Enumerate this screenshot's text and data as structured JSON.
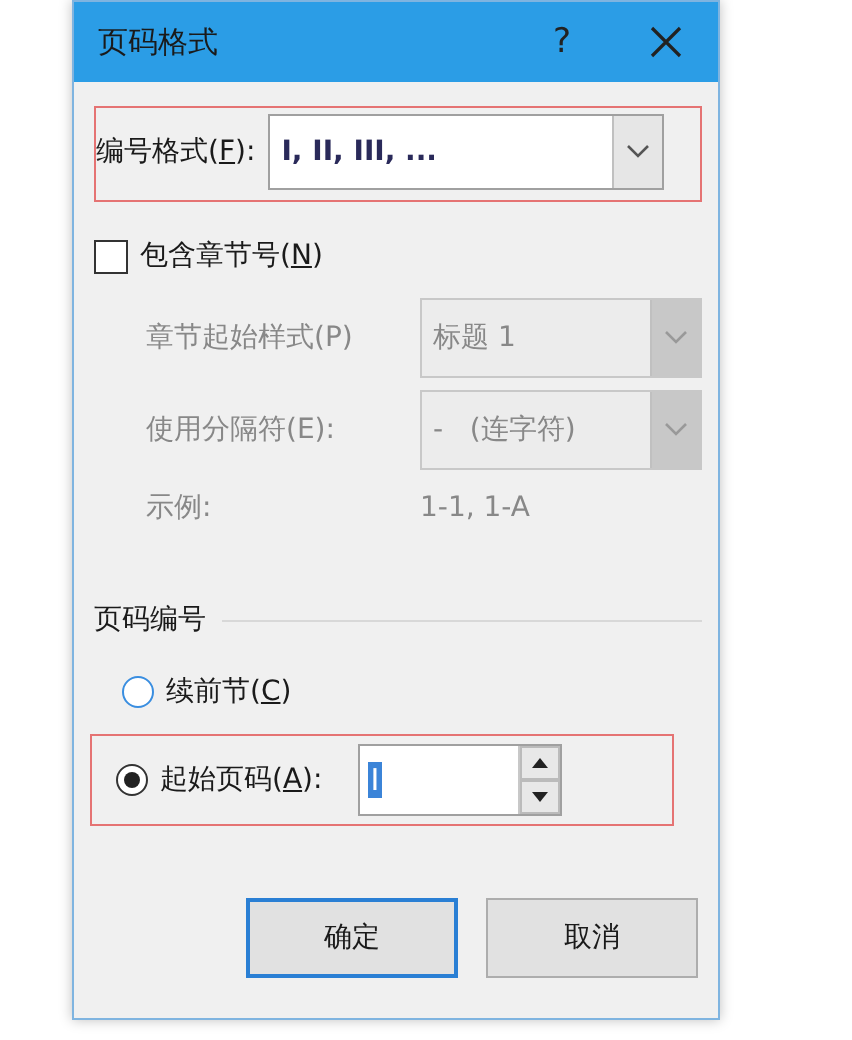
{
  "window": {
    "title": "页码格式",
    "help": "?"
  },
  "number_format": {
    "label": "编号格式(",
    "access_key": "F",
    "label_end": "):",
    "value": "I, II, III, ..."
  },
  "include_chapter": {
    "label": "包含章节号(",
    "access_key": "N",
    "label_end": ")",
    "checked": false
  },
  "chapter_fields": [
    {
      "label": "章节起始样式(P)",
      "kind": "combo",
      "value": "标题 1",
      "disabled": true
    },
    {
      "label": "使用分隔符(E):",
      "kind": "combo",
      "value": "-   (连字符)",
      "disabled": true
    },
    {
      "label": "示例:",
      "kind": "text",
      "value": "1-1, 1-A",
      "disabled": true
    }
  ],
  "page_numbering": {
    "title": "页码编号",
    "options": [
      {
        "label": "续前节(",
        "access_key": "C",
        "label_end": ")",
        "selected": false
      },
      {
        "label": "起始页码(",
        "access_key": "A",
        "label_end": "):",
        "selected": true,
        "value": "I"
      }
    ]
  },
  "buttons": [
    {
      "label": "确定",
      "default": true
    },
    {
      "label": "取消",
      "default": false
    }
  ]
}
